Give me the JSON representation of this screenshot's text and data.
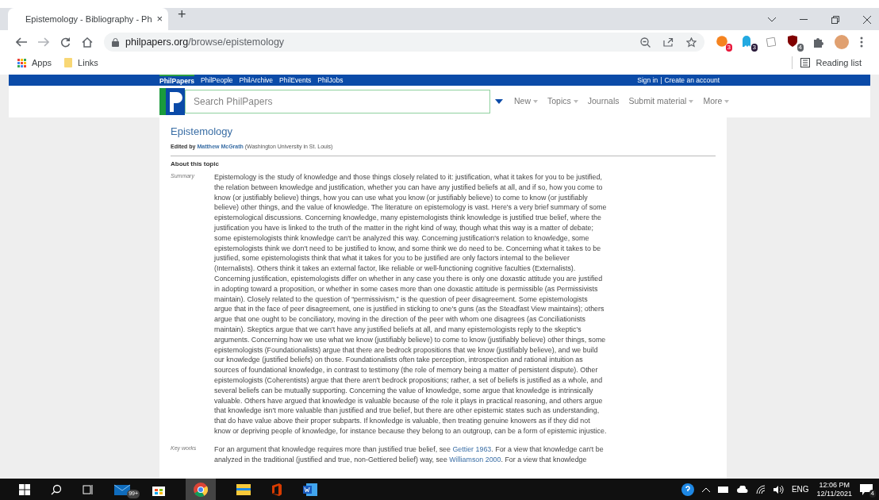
{
  "browser": {
    "tab": {
      "title": "Epistemology - Bibliography - Ph",
      "close": "×",
      "selected": true
    },
    "new_tab": "+",
    "url": {
      "host": "philpapers.org",
      "path": "/browse/epistemology"
    },
    "extension_badges": [
      {
        "count": "3",
        "color": "#e8173a"
      },
      {
        "count": "3",
        "color": "#2a1a3a"
      },
      {
        "count": "4",
        "color": "#5f6368"
      }
    ],
    "bookmarks": [
      "Apps",
      "Links"
    ],
    "reading_list": "Reading list"
  },
  "site": {
    "nav_links": [
      {
        "label": "PhilPapers",
        "selected": true
      },
      {
        "label": "PhilPeople",
        "selected": false
      },
      {
        "label": "PhilArchive",
        "selected": false
      },
      {
        "label": "PhilEvents",
        "selected": false
      },
      {
        "label": "PhilJobs",
        "selected": false
      }
    ],
    "account_links": {
      "sign_in": "Sign in",
      "separator": "|",
      "create": "Create an account"
    },
    "search": {
      "placeholder": "Search PhilPapers"
    },
    "menu": [
      {
        "label": "New",
        "has_caret": true
      },
      {
        "label": "Topics",
        "has_caret": true
      },
      {
        "label": "Journals",
        "has_caret": false
      },
      {
        "label": "Submit material",
        "has_caret": true
      },
      {
        "label": "More",
        "has_caret": true
      }
    ],
    "title": "Epistemology",
    "edited_by": {
      "prefix": "Edited by",
      "editor": "Matthew McGrath",
      "affiliation": "(Washington University in St. Louis)"
    },
    "section": "About this topic",
    "summary": {
      "label": "Summary",
      "text": "Epistemology is the study of knowledge and those things closely related to it: justification, what it takes for you to be justified, the relation between knowledge and justification, whether you can have any justified beliefs at all, and if so, how you come to know (or justifiably believe) things, how you can use what you know (or justifiably believe) to come to know (or justifiably believe) other things, and the value of knowledge. The literature on epistemology is vast. Here's a very brief summary of some epistemological discussions. Concerning knowledge, many epistemologists think knowledge is justified true belief, where the justification you have is linked to the truth of the matter in the right kind of way, though what this way is a matter of debate; some epistemologists think knowledge can't be analyzed this way. Concerning justification's relation to knowledge, some epistemologists think we don't need to be justified to know, and some think we do need to be. Concerning what it takes to be justified, some epistemologists think that what it takes for you to be justified are only factors internal to the believer (Internalists). Others think it takes an external factor, like reliable or well-functioning cognitive faculties (Externalists). Concerning justification, epistemologists differ on whether in any case you there is only one doxastic attitude you are justified in adopting toward a proposition, or whether in some cases more than one doxastic attitude is permissible (as Permissivists maintain). Closely related to the question of “permissivism,” is the question of peer disagreement. Some epistemologists argue that in the face of peer disagreement, one is justified in sticking to one's guns (as the Steadfast View maintains); others argue that one ought to be conciliatory, moving in the direction of the peer with whom one disagrees (as Conciliationists maintain). Skeptics argue that we can't have any justified beliefs at all, and many epistemologists reply to the skeptic's arguments. Concerning how we use what we know (justifiably believe) to come to know (justifiably believe) other things, some epistemologists (Foundationalists) argue that there are bedrock propositions that we know (justifiably believe), and we build our knowledge (justified beliefs) on those. Foundationalists often take perception, introspection and rational intuition as sources of foundational knowledge, in contrast to testimony (the role of memory being a matter of persistent dispute). Other epistemologists (Coherentists) argue that there aren't bedrock propositions; rather, a set of beliefs is justified as a whole, and several beliefs can be mutually supporting. Concerning the value of knowledge, some argue that knowledge is intrinsically valuable. Others have argued that knowledge is valuable because of the role it plays in practical reasoning, and others argue that knowledge isn't more valuable than justified and true belief, but there are other epistemic states such as understanding, that do have value above their proper subparts. If knowledge is valuable, then treating genuine knowers as if they did not know or depriving people of knowledge, for instance because they belong to an outgroup, can be a form of epistemic injustice."
    },
    "key_works": {
      "label": "Key works",
      "segments": [
        {
          "text": "For an argument that knowledge requires more than justified true belief, see ",
          "link": false
        },
        {
          "text": "Gettier 1963",
          "link": true
        },
        {
          "text": ". For a view that knowledge can't be analyzed in the traditional (justified and true, non-Gettiered belief) way, see ",
          "link": false
        },
        {
          "text": "Williamson 2000",
          "link": true
        },
        {
          "text": ". For a view that knowledge",
          "link": false
        }
      ]
    }
  },
  "taskbar": {
    "mail_badge": "99+",
    "language": "ENG",
    "time": "12:06 PM",
    "date": "12/11/2021",
    "notifications": "4"
  }
}
